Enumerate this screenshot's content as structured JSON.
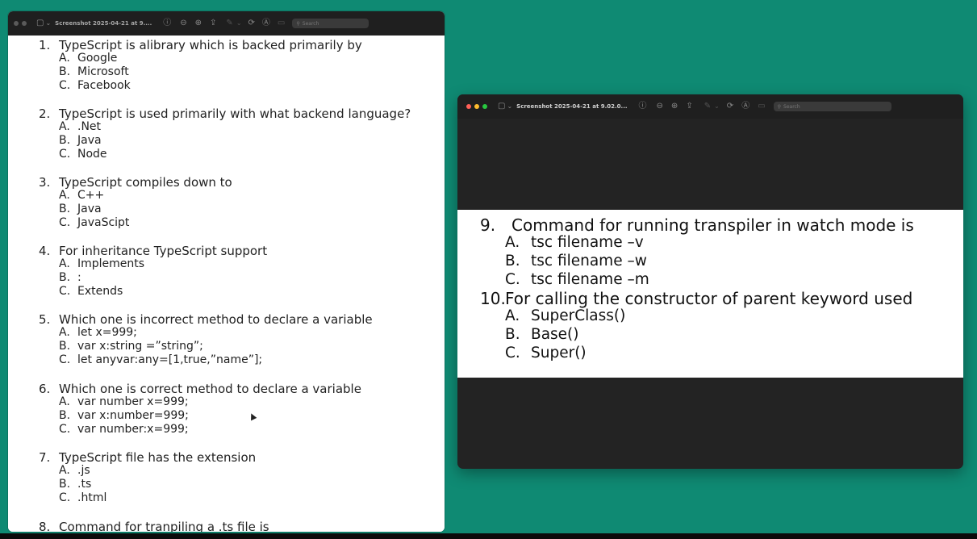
{
  "left_window": {
    "title": "Screenshot 2025-04-21 at 9....",
    "search_placeholder": "Search",
    "questions": [
      {
        "num": "1.",
        "text": "TypeScript is alibrary which is backed primarily by",
        "options": [
          {
            "label": "A.",
            "text": "Google"
          },
          {
            "label": "B.",
            "text": "Microsoft"
          },
          {
            "label": "C.",
            "text": "Facebook"
          }
        ]
      },
      {
        "num": "2.",
        "text": "TypeScript is used primarily with what backend language?",
        "options": [
          {
            "label": "A.",
            "text": ".Net"
          },
          {
            "label": "B.",
            "text": "Java"
          },
          {
            "label": "C.",
            "text": "Node"
          }
        ]
      },
      {
        "num": "3.",
        "text": "TypeScript compiles down to",
        "options": [
          {
            "label": "A.",
            "text": "C++"
          },
          {
            "label": "B.",
            "text": "Java"
          },
          {
            "label": "C.",
            "text": "JavaScipt"
          }
        ]
      },
      {
        "num": "4.",
        "text": "For inheritance TypeScript support",
        "options": [
          {
            "label": "A.",
            "text": "Implements"
          },
          {
            "label": "B.",
            "text": ":"
          },
          {
            "label": "C.",
            "text": "Extends"
          }
        ]
      },
      {
        "num": "5.",
        "text": "Which one is incorrect method to declare a variable",
        "options": [
          {
            "label": "A.",
            "text": "let x=999;"
          },
          {
            "label": "B.",
            "text": "var x:string =”string”;"
          },
          {
            "label": "C.",
            "text": "let anyvar:any=[1,true,”name”];"
          }
        ]
      },
      {
        "num": "6.",
        "text": "Which one is correct method to declare a variable",
        "options": [
          {
            "label": "A.",
            "text": "var number x=999;"
          },
          {
            "label": "B.",
            "text": "var x:number=999;"
          },
          {
            "label": "C.",
            "text": "var number:x=999;"
          }
        ]
      },
      {
        "num": "7.",
        "text": "TypeScript file has the extension",
        "options": [
          {
            "label": "A.",
            "text": ".js"
          },
          {
            "label": "B.",
            "text": ".ts"
          },
          {
            "label": "C.",
            "text": ".html"
          }
        ]
      },
      {
        "num": "8.",
        "text": "Command for tranpiling a .ts file is",
        "options": []
      }
    ]
  },
  "right_window": {
    "title": "Screenshot 2025-04-21 at 9.02.0...",
    "search_placeholder": "Search",
    "questions": [
      {
        "num": "9.",
        "text": "Command for running transpiler in watch mode is",
        "options": [
          {
            "label": "A.",
            "text": "tsc filename –v"
          },
          {
            "label": "B.",
            "text": "tsc filename –w"
          },
          {
            "label": "C.",
            "text": "tsc filename –m"
          }
        ]
      },
      {
        "num": "10.",
        "text": "For calling the constructor of parent keyword used",
        "options": [
          {
            "label": "A.",
            "text": "SuperClass()"
          },
          {
            "label": "B.",
            "text": "Base()"
          },
          {
            "label": "C.",
            "text": "Super()"
          }
        ]
      }
    ]
  },
  "icons": {
    "sidebar": "▢",
    "chevron": "⌄",
    "info": "ⓘ",
    "zoom_out": "⊖",
    "zoom_in": "⊕",
    "share": "⇪",
    "markup": "✎",
    "rotate": "⟳",
    "annotate": "Ⓐ",
    "form": "▭",
    "search": "⚲"
  },
  "colors": {
    "desktop": "#0f8a73",
    "traffic_close": "#ff5f57",
    "traffic_min": "#febc2e",
    "traffic_max": "#28c840"
  }
}
